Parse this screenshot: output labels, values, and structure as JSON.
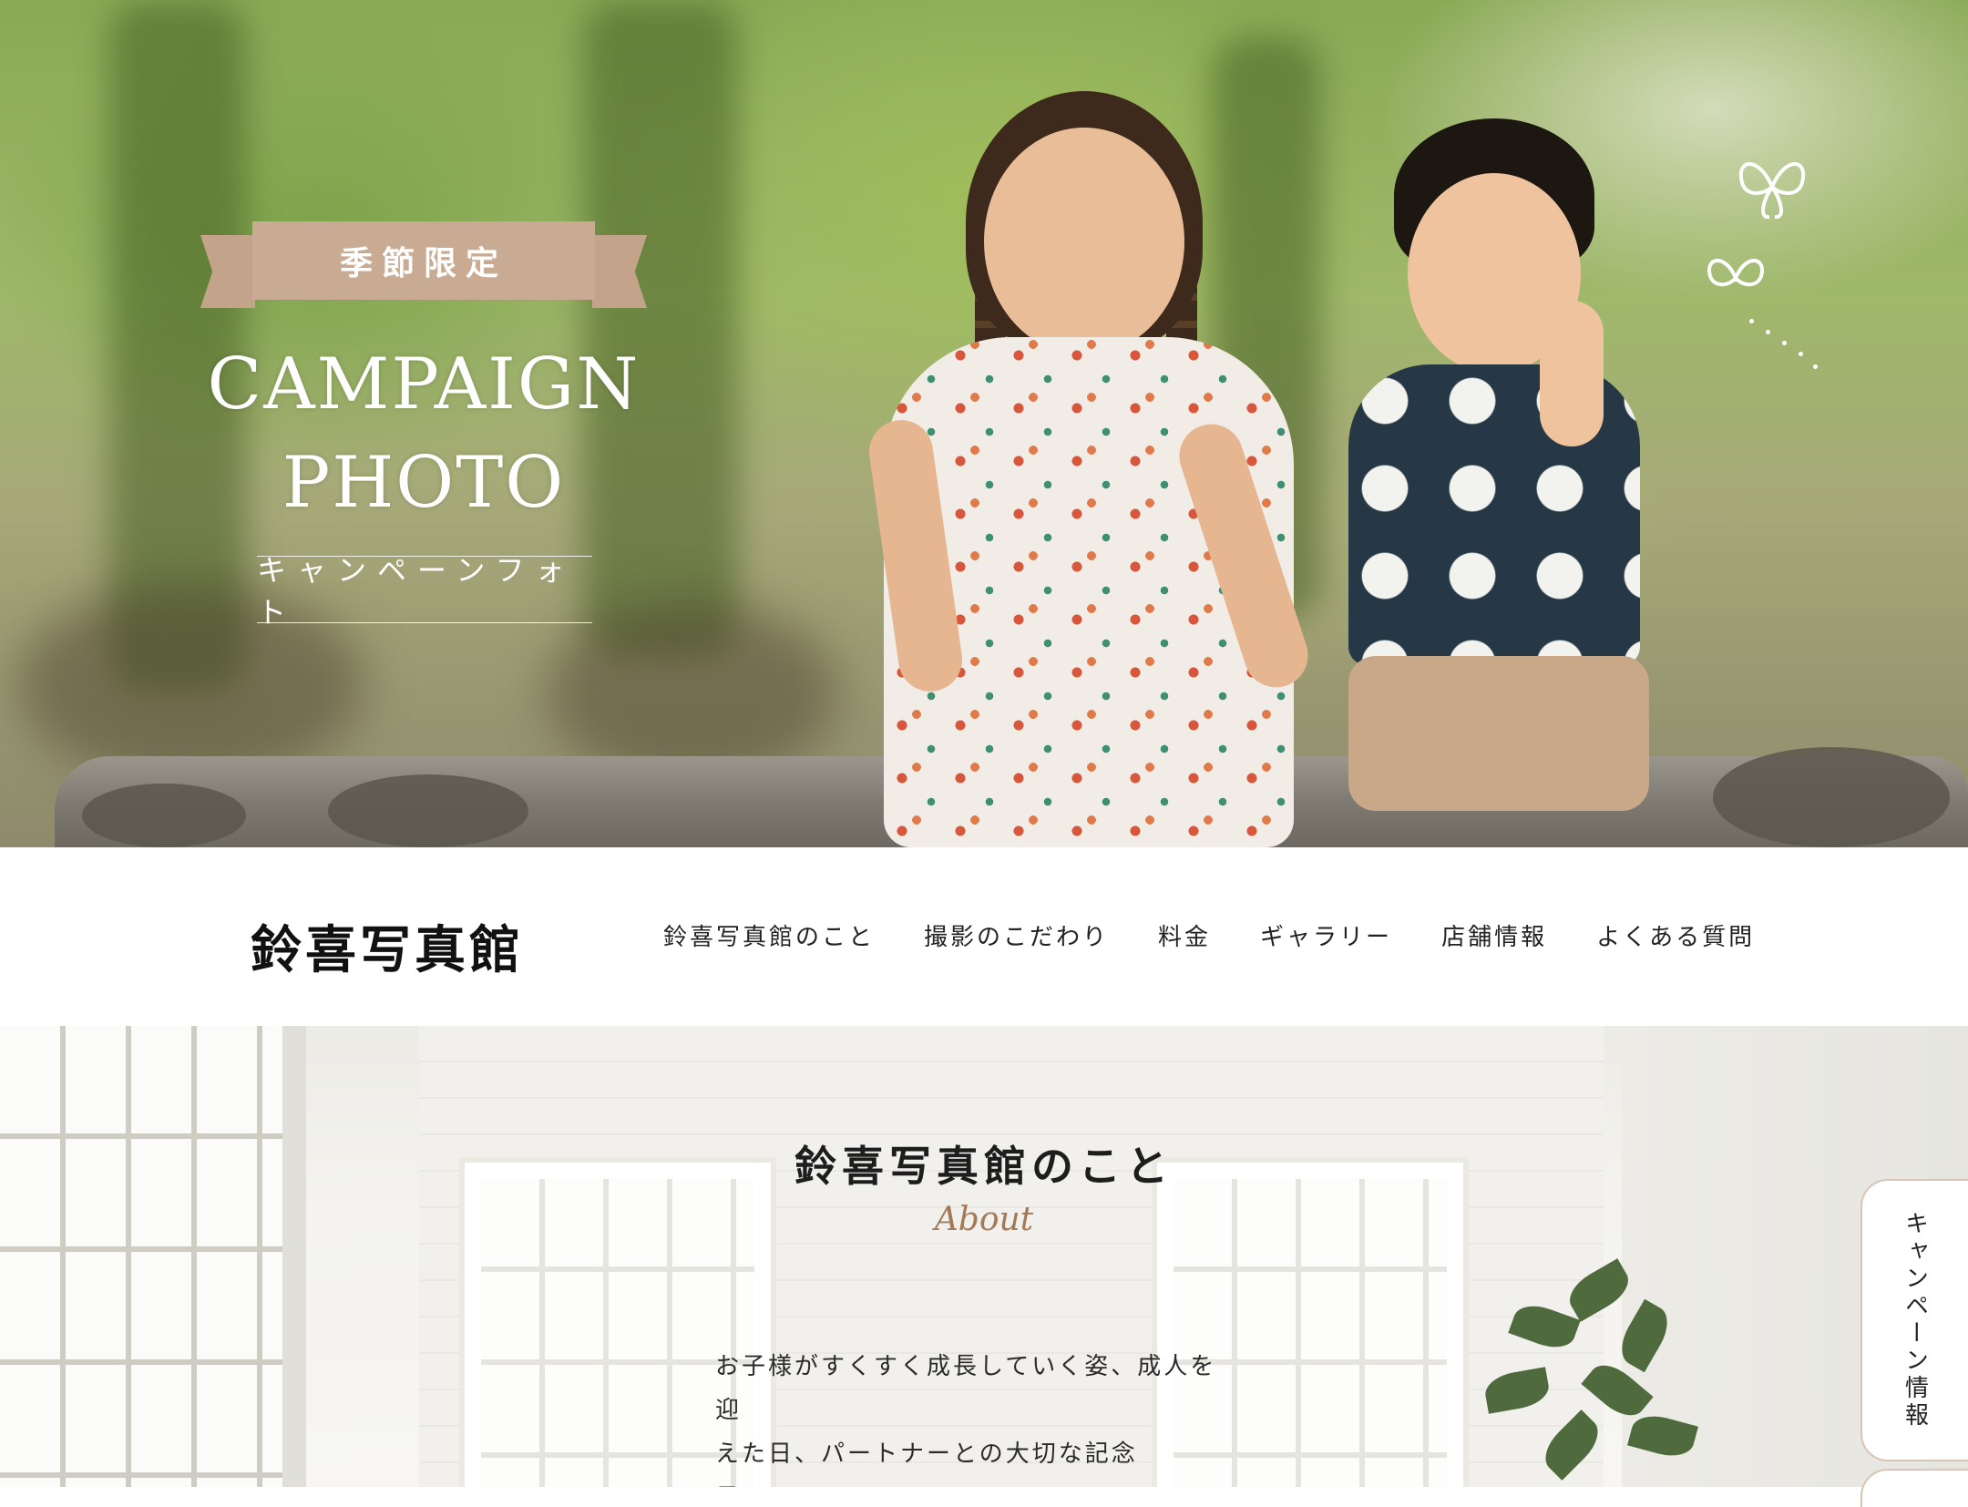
{
  "hero": {
    "ribbon_label": "季節限定",
    "title_line1": "CAMPAIGN",
    "title_line2": "PHOTO",
    "subtitle": "キャンペーンフォト",
    "butterfly_icon": "butterfly-icon"
  },
  "nav": {
    "logo": "鈴喜写真館",
    "items": [
      {
        "label": "鈴喜写真館のこと"
      },
      {
        "label": "撮影のこだわり"
      },
      {
        "label": "料金"
      },
      {
        "label": "ギャラリー"
      },
      {
        "label": "店舗情報"
      },
      {
        "label": "よくある質問"
      }
    ]
  },
  "about": {
    "title": "鈴喜写真館のこと",
    "subtitle_en": "About",
    "body_line1": "お子様がすくすく成長していく姿、成人を迎",
    "body_line2": "えた日、パートナーとの大切な記念日・・・"
  },
  "side_tab": {
    "label": "キャンペーン情報"
  },
  "colors": {
    "ribbon": "#c9ab93",
    "accent_text": "#a27a55",
    "tab_border": "#d8c6b4"
  }
}
